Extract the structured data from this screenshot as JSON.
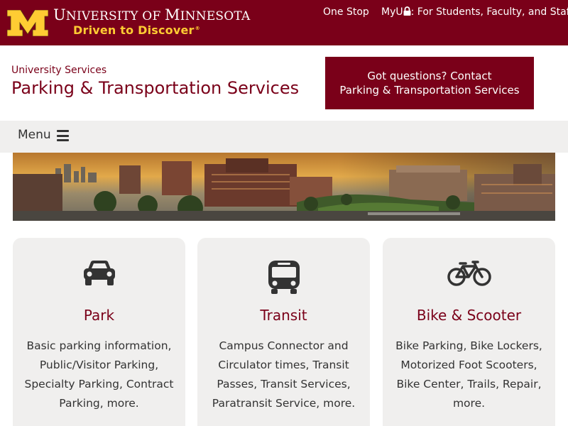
{
  "topbar": {
    "university_first": "U",
    "university_rest": "NIVERSITY OF ",
    "university_m": "M",
    "university_end": "INNESOTA",
    "tagline": "Driven to Discover",
    "tagline_mark": "®",
    "links": {
      "one_stop": "One Stop",
      "myu_prefix": "MyU",
      "myu_suffix": ": For Students, Faculty, and Staff"
    },
    "colors": {
      "maroon": "#7a0019",
      "gold": "#ffcc33"
    }
  },
  "header": {
    "parent": "University Services",
    "title": "Parking & Transportation Services",
    "contact_line1": "Got questions? Contact",
    "contact_line2": "Parking & Transportation Services"
  },
  "menu": {
    "label": "Menu"
  },
  "cards": [
    {
      "icon": "car-icon",
      "title": "Park",
      "lines": [
        "Basic parking information,",
        "Public/Visitor Parking,",
        "Specialty Parking, Contract",
        "Parking, more."
      ]
    },
    {
      "icon": "bus-icon",
      "title": "Transit",
      "lines": [
        "Campus Connector and",
        "Circulator times, Transit",
        "Passes, Transit Services,",
        "Paratransit Service, more."
      ]
    },
    {
      "icon": "bicycle-icon",
      "title": "Bike & Scooter",
      "lines": [
        "Bike Parking, Bike Lockers,",
        "Motorized Foot Scooters,",
        "Bike Center, Trails, Repair,",
        "more."
      ]
    }
  ]
}
